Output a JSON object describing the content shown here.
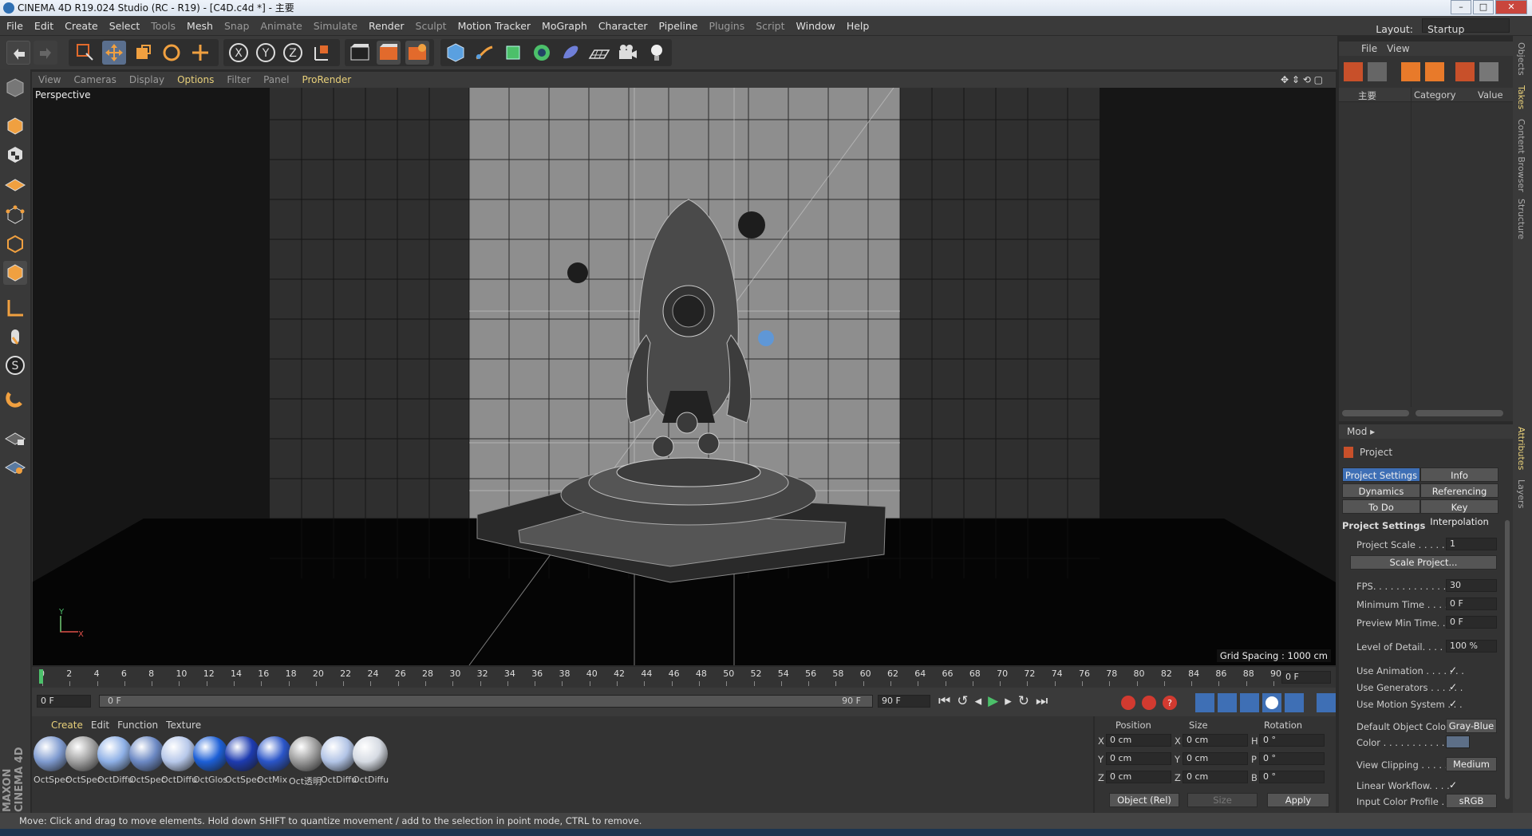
{
  "window": {
    "title": "CINEMA 4D R19.024 Studio (RC - R19) - [C4D.c4d *] - 主要"
  },
  "menu": [
    "File",
    "Edit",
    "Create",
    "Select",
    "Tools",
    "Mesh",
    "Snap",
    "Animate",
    "Simulate",
    "Render",
    "Sculpt",
    "Motion Tracker",
    "MoGraph",
    "Character",
    "Pipeline",
    "Plugins",
    "Script",
    "Window",
    "Help"
  ],
  "menu_dim": [
    "Tools",
    "Snap",
    "Animate",
    "Simulate",
    "Sculpt",
    "Plugins",
    "Script"
  ],
  "layout": {
    "label": "Layout:",
    "value": "Startup"
  },
  "viewport_menu": [
    "View",
    "Cameras",
    "Display",
    "Options",
    "Filter",
    "Panel",
    "ProRender"
  ],
  "viewport": {
    "name": "Perspective",
    "grid_spacing": "Grid Spacing : 1000 cm",
    "axis_y": "Y",
    "axis_x": "X"
  },
  "timeline": {
    "ticks": [
      "0",
      "2",
      "4",
      "6",
      "8",
      "10",
      "12",
      "14",
      "16",
      "18",
      "20",
      "22",
      "24",
      "26",
      "28",
      "30",
      "32",
      "34",
      "36",
      "38",
      "40",
      "42",
      "44",
      "46",
      "48",
      "50",
      "52",
      "54",
      "56",
      "58",
      "60",
      "62",
      "64",
      "66",
      "68",
      "70",
      "72",
      "74",
      "76",
      "78",
      "80",
      "82",
      "84",
      "86",
      "88",
      "90"
    ],
    "current": "0 F"
  },
  "transport": {
    "start": "0 F",
    "slider_start": "0 F",
    "slider_end": "90 F",
    "end": "90 F"
  },
  "materials": {
    "tabs": [
      "Create",
      "Edit",
      "Function",
      "Texture"
    ],
    "items": [
      "OctSpec",
      "OctSpec",
      "OctDiffu",
      "OctSpec",
      "OctDiffu",
      "OctGlos",
      "OctSpec",
      "OctMix",
      "Oct透明",
      "OctDiffu",
      "OctDiffu"
    ],
    "colors": [
      "#7f9bd0",
      "#a0a0a0",
      "#8eb0e6",
      "#6c89c4",
      "#b7c8ea",
      "#1c5fd6",
      "#1d3bb0",
      "#2a55c8",
      "#9a9a9a",
      "#b2c4e6",
      "#d6dbe3"
    ]
  },
  "coords": {
    "headers": [
      "Position",
      "Size",
      "Rotation"
    ],
    "rows": [
      {
        "a": "X",
        "av": "0 cm",
        "b": "X",
        "bv": "0 cm",
        "c": "H",
        "cv": "0 °"
      },
      {
        "a": "Y",
        "av": "0 cm",
        "b": "Y",
        "bv": "0 cm",
        "c": "P",
        "cv": "0 °"
      },
      {
        "a": "Z",
        "av": "0 cm",
        "b": "Z",
        "bv": "0 cm",
        "c": "B",
        "cv": "0 °"
      }
    ],
    "mode": "Object (Rel)",
    "size_mode": "Size",
    "apply": "Apply"
  },
  "status": "Move: Click and drag to move elements. Hold down SHIFT to quantize movement / add to the selection in point mode, CTRL to remove.",
  "objects_panel": {
    "menu": [
      "File",
      "View"
    ],
    "col_name": "主要",
    "col_category": "Category",
    "col_value": "Value"
  },
  "attributes": {
    "mode": "Mod",
    "object": "Project",
    "tabs": [
      "Project Settings",
      "Info",
      "Dynamics",
      "Referencing",
      "To Do",
      "Key Interpolation"
    ],
    "section": "Project Settings",
    "rows": [
      {
        "label": "Project Scale . . . . . . .",
        "value": "1"
      },
      {
        "label": "FPS. . . . . . . . . . . . . . . .",
        "value": "30"
      },
      {
        "label": "Minimum Time . . . . . .",
        "value": "0 F"
      },
      {
        "label": "Preview Min Time. . . .",
        "value": "0 F"
      },
      {
        "label": "Level of Detail. . . . . .",
        "value": "100 %"
      }
    ],
    "scale_button": "Scale Project...",
    "checks": [
      "Use Animation . . . . . . .",
      "Use Generators . . . . . .",
      "Use Motion System . . ."
    ],
    "check_mark": "✓",
    "default_color_label": "Default Object Color",
    "default_color_value": "Gray-Blue",
    "color_label": "Color . . . . . . . . . . .",
    "view_clipping_label": "View Clipping . . . . . .",
    "view_clipping_value": "Medium",
    "linear_workflow": "Linear Workflow. . . .",
    "input_color_profile_label": "Input Color Profile . .",
    "input_color_profile_value": "sRGB"
  },
  "side_tabs": [
    "Objects",
    "Takes",
    "Content Browser",
    "Structure",
    "Attributes",
    "Layers"
  ]
}
